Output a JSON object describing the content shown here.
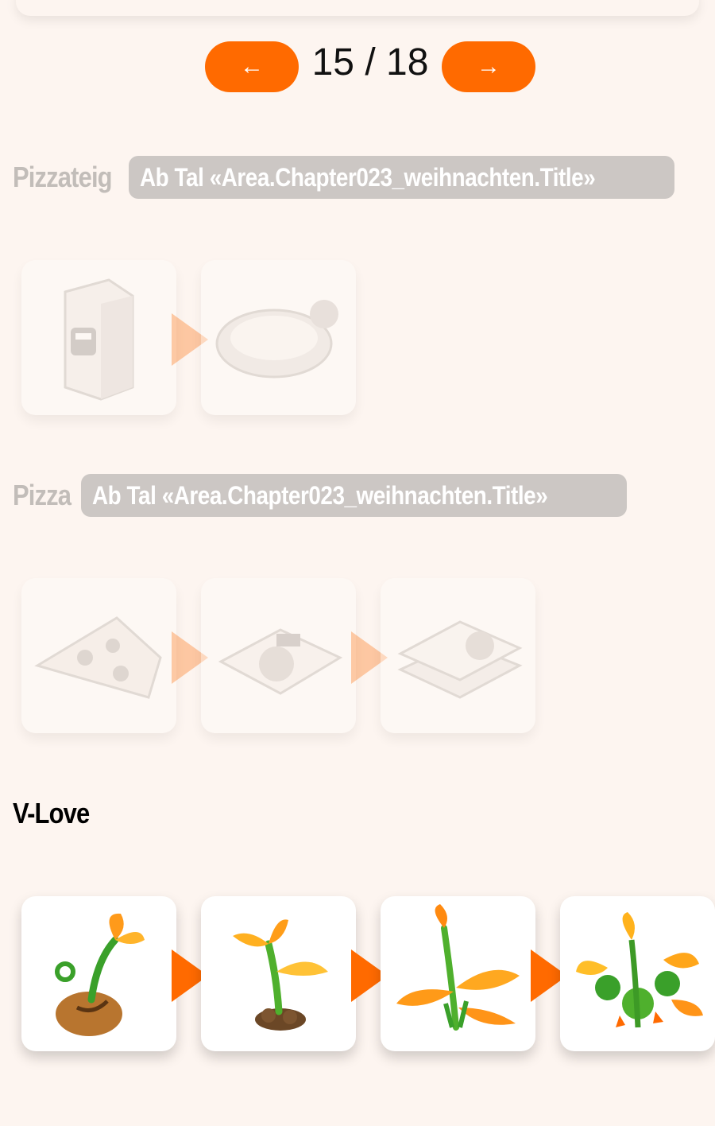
{
  "pager": {
    "prev_label": "←",
    "next_label": "→",
    "page_text": "15 / 18"
  },
  "sections": [
    {
      "name": "Pizzateig",
      "badge": "Ab Tal «Area.Chapter023_weihnachten.Title»",
      "items": [
        "flour-bag-icon",
        "pizza-dough-icon"
      ]
    },
    {
      "name": "Pizza",
      "badge": "Ab Tal «Area.Chapter023_weihnachten.Title»",
      "items": [
        "pizza-slice-icon",
        "pizza-box-icon",
        "pizza-box-stack-icon"
      ]
    },
    {
      "name": "V-Love",
      "items": [
        "v-love-seed-icon",
        "v-love-sprout-icon",
        "v-love-plant-icon",
        "v-love-bush-icon"
      ]
    }
  ],
  "colors": {
    "accent": "#ff6a00",
    "background": "#fdf5f0",
    "badge": "#ccc7c4",
    "dim_title": "#c2bdb9"
  }
}
